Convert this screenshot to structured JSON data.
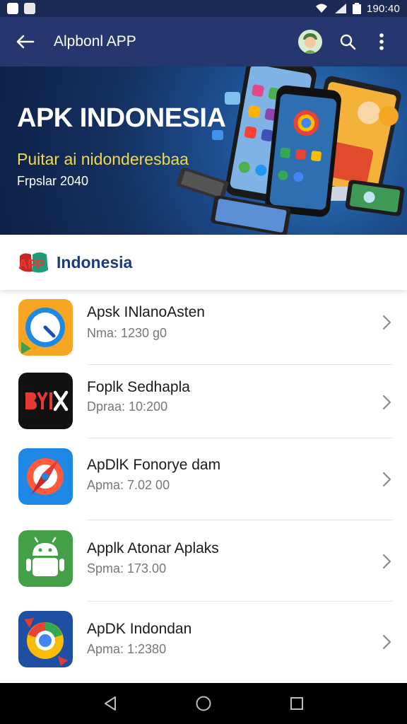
{
  "status_bar": {
    "time": "190:40"
  },
  "app_bar": {
    "title": "Alpbonl APP"
  },
  "banner": {
    "title": "APK INDONESIA",
    "subtitle": "Puitar ai nidonderesbaa",
    "date": "Frpslar 2040"
  },
  "section": {
    "logo_text": "APP",
    "title": "Indonesia"
  },
  "apps": [
    {
      "name": "Apsk INlanoAsten",
      "meta": "Nma: 1230 g0",
      "icon": "timer-icon",
      "icon_color": "#f6a623"
    },
    {
      "name": "Foplk Sedhapla",
      "meta": "Dpraa: 10:200",
      "icon": "byx-logo-icon",
      "icon_color": "#111111"
    },
    {
      "name": "ApDlK Fonorye dam",
      "meta": "Apma: 7.02 00",
      "icon": "compass-icon",
      "icon_color": "#1e88e5"
    },
    {
      "name": "Applk Atonar Aplaks",
      "meta": "Spma: 173.00",
      "icon": "android-icon",
      "icon_color": "#43a047"
    },
    {
      "name": "ApDK Indondan",
      "meta": "Apma: 1:2380",
      "icon": "chrome-lens-icon",
      "icon_color": "#1e4fa3"
    }
  ],
  "colors": {
    "status_bar": "#1b2a55",
    "app_bar": "#26366e",
    "accent_yellow": "#f3d949",
    "section_title": "#1f3a78"
  }
}
